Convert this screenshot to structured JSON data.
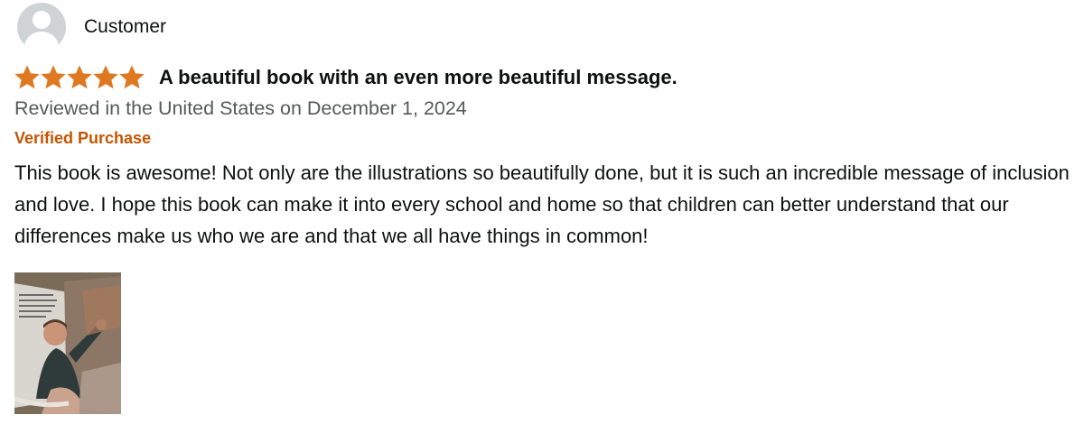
{
  "profile": {
    "name": "Customer",
    "avatar_icon": "user-avatar-icon"
  },
  "review": {
    "rating": 5,
    "rating_max": 5,
    "star_color": "#de7921",
    "star_icon": "star-icon",
    "title": "A beautiful book with an even more beautiful message.",
    "date": "Reviewed in the United States on December 1, 2024",
    "verified_label": "Verified Purchase",
    "verified_color": "#c45500",
    "body": "This book is awesome! Not only are the illustrations so beautifully done, but it is such an incredible message of inclusion and love. I hope this book can make it into every school and home so that children can better understand that our differences make us who we are and that we all have things in common!"
  },
  "images": [
    {
      "subject": "customer photo of open book page"
    }
  ]
}
